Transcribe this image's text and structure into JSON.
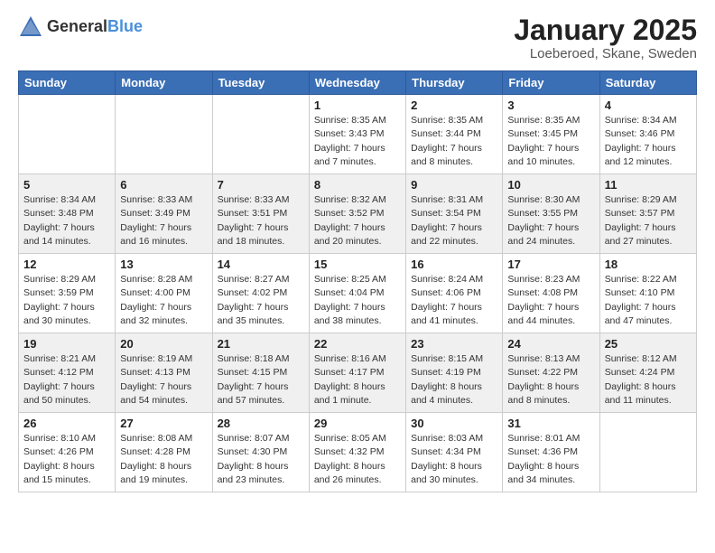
{
  "logo": {
    "general": "General",
    "blue": "Blue"
  },
  "title": "January 2025",
  "subtitle": "Loeberoed, Skane, Sweden",
  "weekdays": [
    "Sunday",
    "Monday",
    "Tuesday",
    "Wednesday",
    "Thursday",
    "Friday",
    "Saturday"
  ],
  "weeks": [
    [
      {
        "day": "",
        "info": ""
      },
      {
        "day": "",
        "info": ""
      },
      {
        "day": "",
        "info": ""
      },
      {
        "day": "1",
        "info": "Sunrise: 8:35 AM\nSunset: 3:43 PM\nDaylight: 7 hours\nand 7 minutes."
      },
      {
        "day": "2",
        "info": "Sunrise: 8:35 AM\nSunset: 3:44 PM\nDaylight: 7 hours\nand 8 minutes."
      },
      {
        "day": "3",
        "info": "Sunrise: 8:35 AM\nSunset: 3:45 PM\nDaylight: 7 hours\nand 10 minutes."
      },
      {
        "day": "4",
        "info": "Sunrise: 8:34 AM\nSunset: 3:46 PM\nDaylight: 7 hours\nand 12 minutes."
      }
    ],
    [
      {
        "day": "5",
        "info": "Sunrise: 8:34 AM\nSunset: 3:48 PM\nDaylight: 7 hours\nand 14 minutes."
      },
      {
        "day": "6",
        "info": "Sunrise: 8:33 AM\nSunset: 3:49 PM\nDaylight: 7 hours\nand 16 minutes."
      },
      {
        "day": "7",
        "info": "Sunrise: 8:33 AM\nSunset: 3:51 PM\nDaylight: 7 hours\nand 18 minutes."
      },
      {
        "day": "8",
        "info": "Sunrise: 8:32 AM\nSunset: 3:52 PM\nDaylight: 7 hours\nand 20 minutes."
      },
      {
        "day": "9",
        "info": "Sunrise: 8:31 AM\nSunset: 3:54 PM\nDaylight: 7 hours\nand 22 minutes."
      },
      {
        "day": "10",
        "info": "Sunrise: 8:30 AM\nSunset: 3:55 PM\nDaylight: 7 hours\nand 24 minutes."
      },
      {
        "day": "11",
        "info": "Sunrise: 8:29 AM\nSunset: 3:57 PM\nDaylight: 7 hours\nand 27 minutes."
      }
    ],
    [
      {
        "day": "12",
        "info": "Sunrise: 8:29 AM\nSunset: 3:59 PM\nDaylight: 7 hours\nand 30 minutes."
      },
      {
        "day": "13",
        "info": "Sunrise: 8:28 AM\nSunset: 4:00 PM\nDaylight: 7 hours\nand 32 minutes."
      },
      {
        "day": "14",
        "info": "Sunrise: 8:27 AM\nSunset: 4:02 PM\nDaylight: 7 hours\nand 35 minutes."
      },
      {
        "day": "15",
        "info": "Sunrise: 8:25 AM\nSunset: 4:04 PM\nDaylight: 7 hours\nand 38 minutes."
      },
      {
        "day": "16",
        "info": "Sunrise: 8:24 AM\nSunset: 4:06 PM\nDaylight: 7 hours\nand 41 minutes."
      },
      {
        "day": "17",
        "info": "Sunrise: 8:23 AM\nSunset: 4:08 PM\nDaylight: 7 hours\nand 44 minutes."
      },
      {
        "day": "18",
        "info": "Sunrise: 8:22 AM\nSunset: 4:10 PM\nDaylight: 7 hours\nand 47 minutes."
      }
    ],
    [
      {
        "day": "19",
        "info": "Sunrise: 8:21 AM\nSunset: 4:12 PM\nDaylight: 7 hours\nand 50 minutes."
      },
      {
        "day": "20",
        "info": "Sunrise: 8:19 AM\nSunset: 4:13 PM\nDaylight: 7 hours\nand 54 minutes."
      },
      {
        "day": "21",
        "info": "Sunrise: 8:18 AM\nSunset: 4:15 PM\nDaylight: 7 hours\nand 57 minutes."
      },
      {
        "day": "22",
        "info": "Sunrise: 8:16 AM\nSunset: 4:17 PM\nDaylight: 8 hours\nand 1 minute."
      },
      {
        "day": "23",
        "info": "Sunrise: 8:15 AM\nSunset: 4:19 PM\nDaylight: 8 hours\nand 4 minutes."
      },
      {
        "day": "24",
        "info": "Sunrise: 8:13 AM\nSunset: 4:22 PM\nDaylight: 8 hours\nand 8 minutes."
      },
      {
        "day": "25",
        "info": "Sunrise: 8:12 AM\nSunset: 4:24 PM\nDaylight: 8 hours\nand 11 minutes."
      }
    ],
    [
      {
        "day": "26",
        "info": "Sunrise: 8:10 AM\nSunset: 4:26 PM\nDaylight: 8 hours\nand 15 minutes."
      },
      {
        "day": "27",
        "info": "Sunrise: 8:08 AM\nSunset: 4:28 PM\nDaylight: 8 hours\nand 19 minutes."
      },
      {
        "day": "28",
        "info": "Sunrise: 8:07 AM\nSunset: 4:30 PM\nDaylight: 8 hours\nand 23 minutes."
      },
      {
        "day": "29",
        "info": "Sunrise: 8:05 AM\nSunset: 4:32 PM\nDaylight: 8 hours\nand 26 minutes."
      },
      {
        "day": "30",
        "info": "Sunrise: 8:03 AM\nSunset: 4:34 PM\nDaylight: 8 hours\nand 30 minutes."
      },
      {
        "day": "31",
        "info": "Sunrise: 8:01 AM\nSunset: 4:36 PM\nDaylight: 8 hours\nand 34 minutes."
      },
      {
        "day": "",
        "info": ""
      }
    ]
  ]
}
